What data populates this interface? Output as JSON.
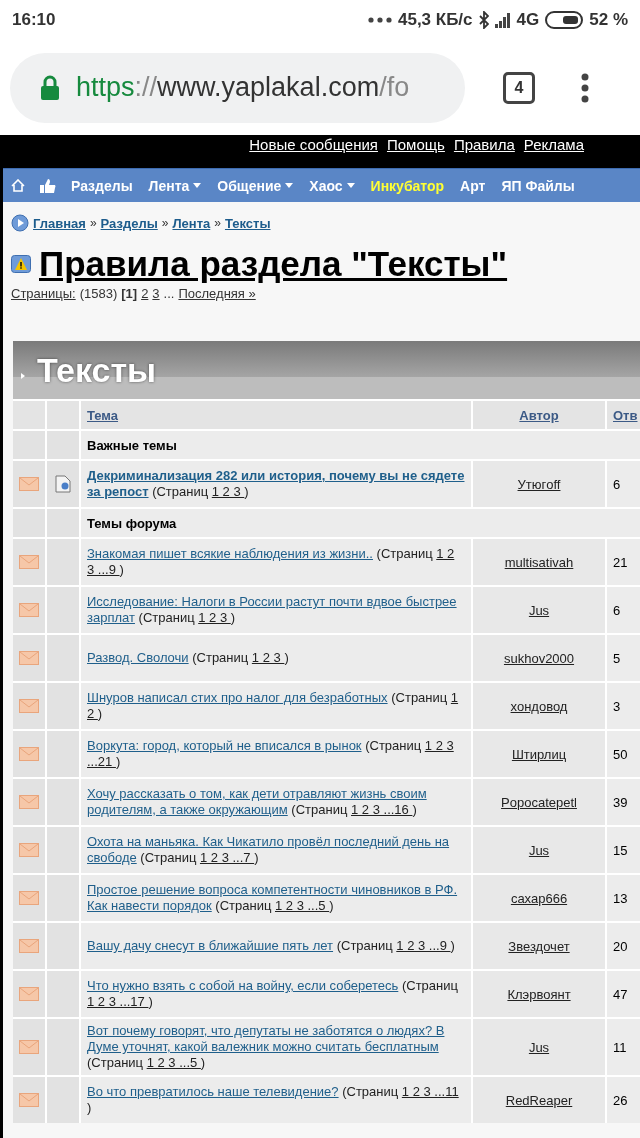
{
  "status_bar": {
    "time": "16:10",
    "speed": "45,3 КБ/с",
    "network": "4G",
    "battery": "52 %"
  },
  "browser": {
    "url": {
      "scheme": "https",
      "separator": "://",
      "host": "www.yaplakal.com",
      "path": "/fo"
    },
    "tab_count": "4"
  },
  "top_links": [
    "Новые сообщения",
    "Помощь",
    "Правила",
    "Реклама"
  ],
  "nav": [
    {
      "label": "Разделы",
      "dropdown": false,
      "highlighted": false
    },
    {
      "label": "Лента",
      "dropdown": true,
      "highlighted": false
    },
    {
      "label": "Общение",
      "dropdown": true,
      "highlighted": false
    },
    {
      "label": "Хаос",
      "dropdown": true,
      "highlighted": false
    },
    {
      "label": "Инкубатор",
      "dropdown": false,
      "highlighted": true
    },
    {
      "label": "Арт",
      "dropdown": false,
      "highlighted": false
    },
    {
      "label": "ЯП Файлы",
      "dropdown": false,
      "highlighted": false
    }
  ],
  "breadcrumbs": [
    {
      "label": "Главная"
    },
    {
      "separator": "»",
      "label": "Разделы"
    },
    {
      "separator": "»",
      "label": "Лента"
    },
    {
      "separator": "»",
      "label": "Тексты"
    }
  ],
  "page_title": "Правила раздела \"Тексты\"",
  "pager": {
    "label": "Страницы:",
    "count": "(1583)",
    "items": [
      {
        "text": "[1]",
        "selected": true
      },
      {
        "text": "2",
        "selected": false
      },
      {
        "text": "3",
        "selected": false
      }
    ],
    "ellipsis": "...",
    "last": "Последняя »"
  },
  "forum": {
    "title": "Тексты",
    "columns": [
      "Тема",
      "Автор",
      "Отв"
    ],
    "groups": [
      {
        "title": "Важные темы",
        "topics": [
          {
            "kind": "pinned",
            "title": "Декриминализация 282 или история, почему вы не сядете за репост",
            "pages_label": "(Страниц",
            "pages": "1 2 3",
            "suffix": ")",
            "author": "Утюгoff",
            "replies": "6"
          }
        ]
      },
      {
        "title": "Темы форума",
        "topics": [
          {
            "kind": "normal",
            "title": "Знакомая пишет всякие наблюдения из жизни..",
            "pages_label": "(Страниц",
            "pages": "1 2 3 ...9",
            "suffix": ")",
            "author": "multisativah",
            "replies": "21"
          },
          {
            "kind": "normal",
            "title": "Исследование: Налоги в России растут почти вдвое быстрее зарплат",
            "pages_label": "(Страниц",
            "pages": "1 2 3",
            "suffix": ")",
            "author": "Jus",
            "replies": "6"
          },
          {
            "kind": "normal",
            "title": "Развод. Сволочи",
            "pages_label": "(Страниц",
            "pages": "1 2 3",
            "suffix": ")",
            "author": "sukhov2000",
            "replies": "5"
          },
          {
            "kind": "normal",
            "title": "Шнуров написал стих про налог для безработных",
            "pages_label": "(Страниц",
            "pages": "1 2",
            "suffix": ")",
            "author": "хондовод",
            "replies": "3"
          },
          {
            "kind": "normal",
            "title": "Воркута: город, который не вписался в рынок",
            "pages_label": "(Страниц",
            "pages": "1 2 3 ...21",
            "suffix": ")",
            "author": "Штирлиц",
            "replies": "50"
          },
          {
            "kind": "normal",
            "title": "Хочу рассказать о том, как дети отравляют жизнь своим родителям, а также окружающим",
            "pages_label": "(Страниц",
            "pages": "1 2 3 ...16",
            "suffix": ")",
            "author": "Popocatepetl",
            "replies": "39"
          },
          {
            "kind": "normal",
            "title": "Охота на маньяка. Как Чикатило провёл последний день на свободе",
            "pages_label": "(Страниц",
            "pages": "1 2 3 ...7",
            "suffix": ")",
            "author": "Jus",
            "replies": "15"
          },
          {
            "kind": "normal",
            "title": "Простое решение вопроса компетентности чиновников в РФ. Как навести порядок",
            "pages_label": "(Страниц",
            "pages": "1 2 3 ...5",
            "suffix": ")",
            "author": "сахар666",
            "replies": "13"
          },
          {
            "kind": "normal",
            "title": "Вашу дачу снесут в ближайшие пять лет",
            "pages_label": "(Страниц",
            "pages": "1 2 3 ...9",
            "suffix": ")",
            "author": "Звездочет",
            "replies": "20"
          },
          {
            "kind": "normal",
            "title": "Что нужно взять с собой на войну, если соберетесь",
            "pages_label": "(Страниц",
            "pages": "1 2 3 ...17",
            "suffix": ")",
            "author": "Клэрвоянт",
            "replies": "47"
          },
          {
            "kind": "normal",
            "title": "Вот почему говорят, что депутаты не заботятся о людях? В Думе уточнят, какой валежник можно считать бесплатным",
            "pages_label": "(Страниц",
            "pages": "1 2 3 ...5",
            "suffix": ")",
            "author": "Jus",
            "replies": "11"
          },
          {
            "kind": "normal",
            "title": "Во что превратилось наше телевидение?",
            "pages_label": "(Страниц",
            "pages": "1 2 3 ...11",
            "suffix": ")",
            "author": "RedReaper",
            "replies": "26"
          }
        ]
      }
    ]
  }
}
